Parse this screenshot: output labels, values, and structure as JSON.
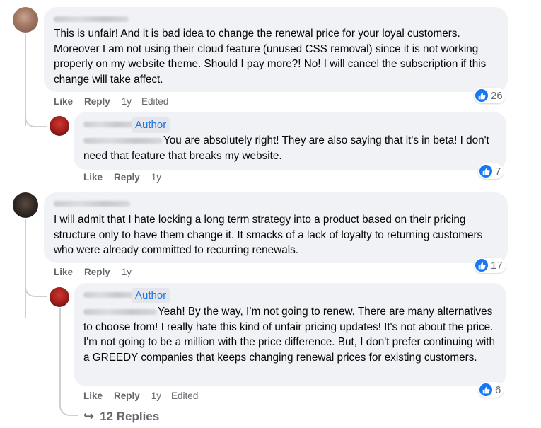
{
  "comments": [
    {
      "body": "This is unfair! And it is bad idea to change the renewal price for your loyal customers. Moreover I am not using their cloud feature (unused CSS removal) since it is not working properly on my website theme. Should I pay more?! No! I will cancel the subscription if this change will take affect.",
      "actions": {
        "like": "Like",
        "reply": "Reply",
        "time": "1y",
        "edited": "Edited"
      },
      "reaction_count": "26",
      "reply": {
        "badge": "Author",
        "body": "You are absolutely right! They are also saying that it's in beta! I don't need that feature that breaks my website.",
        "actions": {
          "like": "Like",
          "reply": "Reply",
          "time": "1y"
        },
        "reaction_count": "7"
      }
    },
    {
      "body": "I will admit that I hate locking a long term strategy into a product based on their pricing structure only to have them change it. It smacks of a lack of loyalty to returning customers who were already committed to recurring renewals.",
      "actions": {
        "like": "Like",
        "reply": "Reply",
        "time": "1y"
      },
      "reaction_count": "17",
      "reply": {
        "badge": "Author",
        "body": "Yeah! By the way, I’m not going to renew. There are many alternatives to choose from! I really hate this kind of unfair pricing updates! It's not about the price. I'm not going to be a million with the price difference. But, I don't prefer continuing with a GREEDY companies that keeps changing renewal prices for existing customers.",
        "actions": {
          "like": "Like",
          "reply": "Reply",
          "time": "1y",
          "edited": "Edited"
        },
        "reaction_count": "6"
      },
      "view_replies": "12 Replies"
    }
  ],
  "colors": {
    "bubble": "#f0f2f5",
    "meta": "#65676b",
    "like_blue": "#1877f2",
    "author": "#1b74e4"
  },
  "icons": {
    "reaction": "like-thumb-icon",
    "replies": "reply-arrow-icon"
  }
}
